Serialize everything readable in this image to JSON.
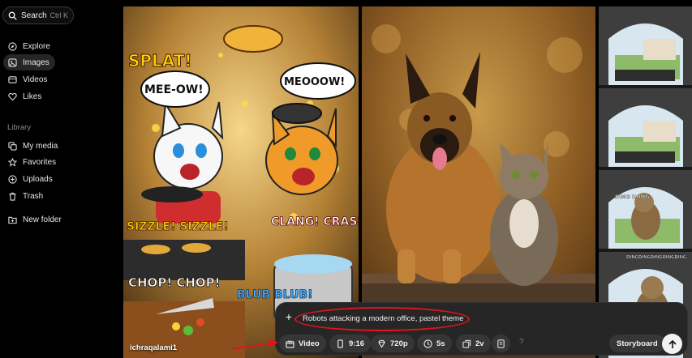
{
  "sidebar": {
    "search_label": "Search",
    "search_shortcut": "Ctrl K",
    "items": [
      {
        "label": "Explore",
        "icon": "compass-icon"
      },
      {
        "label": "Images",
        "icon": "image-icon",
        "active": true
      },
      {
        "label": "Videos",
        "icon": "video-icon"
      },
      {
        "label": "Likes",
        "icon": "heart-icon"
      }
    ],
    "library_heading": "Library",
    "library_items": [
      {
        "label": "My media",
        "icon": "media-icon"
      },
      {
        "label": "Favorites",
        "icon": "star-icon"
      },
      {
        "label": "Uploads",
        "icon": "upload-icon"
      },
      {
        "label": "Trash",
        "icon": "trash-icon"
      },
      {
        "label": "New folder",
        "icon": "folder-plus-icon"
      }
    ]
  },
  "gallery": {
    "comic": {
      "splat": "SPLAT!",
      "meow1": "MEE-OW!",
      "meow2": "MEOOOW!",
      "sizzle": "SIZZLE! SIZZLE!",
      "clang": "CLANG! CRASH!!",
      "chop": "CHOP! CHOP!",
      "blub": "BLUB BLUB!"
    },
    "doorbell_caption_1": "DING DONG",
    "doorbell_caption_2": "DINGDINGDINGDINGDING",
    "username": "ichraqalami1"
  },
  "composer": {
    "prompt_text": "Robots attacking a modern office, pastel theme",
    "mode_label": "Video",
    "aspect_ratio": "9:16",
    "resolution": "720p",
    "duration": "5s",
    "variations": "2v",
    "help_label": "?",
    "storyboard_label": "Storyboard"
  },
  "colors": {
    "annotation_red": "#e0141e",
    "panel_bg": "#262626"
  }
}
